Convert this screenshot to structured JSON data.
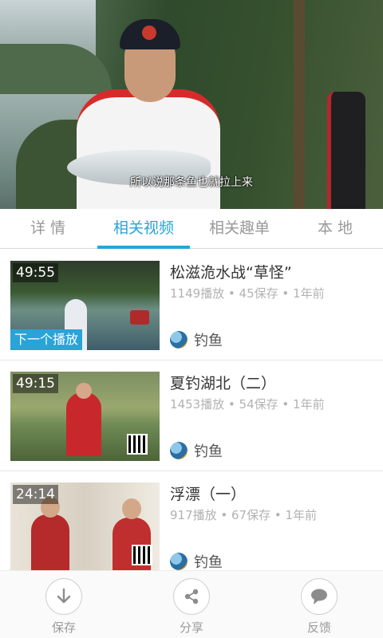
{
  "player": {
    "subtitle": "所以说那条鱼也就拉上来"
  },
  "tabs": [
    {
      "label": "详 情",
      "active": false
    },
    {
      "label": "相关视频",
      "active": true
    },
    {
      "label": "相关趣单",
      "active": false
    },
    {
      "label": "本 地",
      "active": false
    }
  ],
  "videos": [
    {
      "duration": "49:55",
      "badge": "下一个播放",
      "title": "松滋洈水战“草怪”",
      "meta": "1149播放 • 45保存 • 1年前",
      "author": "钓鱼"
    },
    {
      "duration": "49:15",
      "title": "夏钓湖北（二）",
      "meta": "1453播放 • 54保存 • 1年前",
      "author": "钓鱼"
    },
    {
      "duration": "24:14",
      "title": "浮漂（一）",
      "meta": "917播放 • 67保存 • 1年前",
      "author": "钓鱼"
    }
  ],
  "actions": {
    "save": {
      "label": "保存",
      "icon": "download-icon"
    },
    "share": {
      "label": "分享",
      "icon": "share-icon"
    },
    "feedback": {
      "label": "反馈",
      "icon": "chat-bubble-icon"
    }
  },
  "colors": {
    "accent": "#29a3d8",
    "title_text": "#333333",
    "meta_text": "#b2b2b2",
    "inactive_tab": "#999999"
  }
}
